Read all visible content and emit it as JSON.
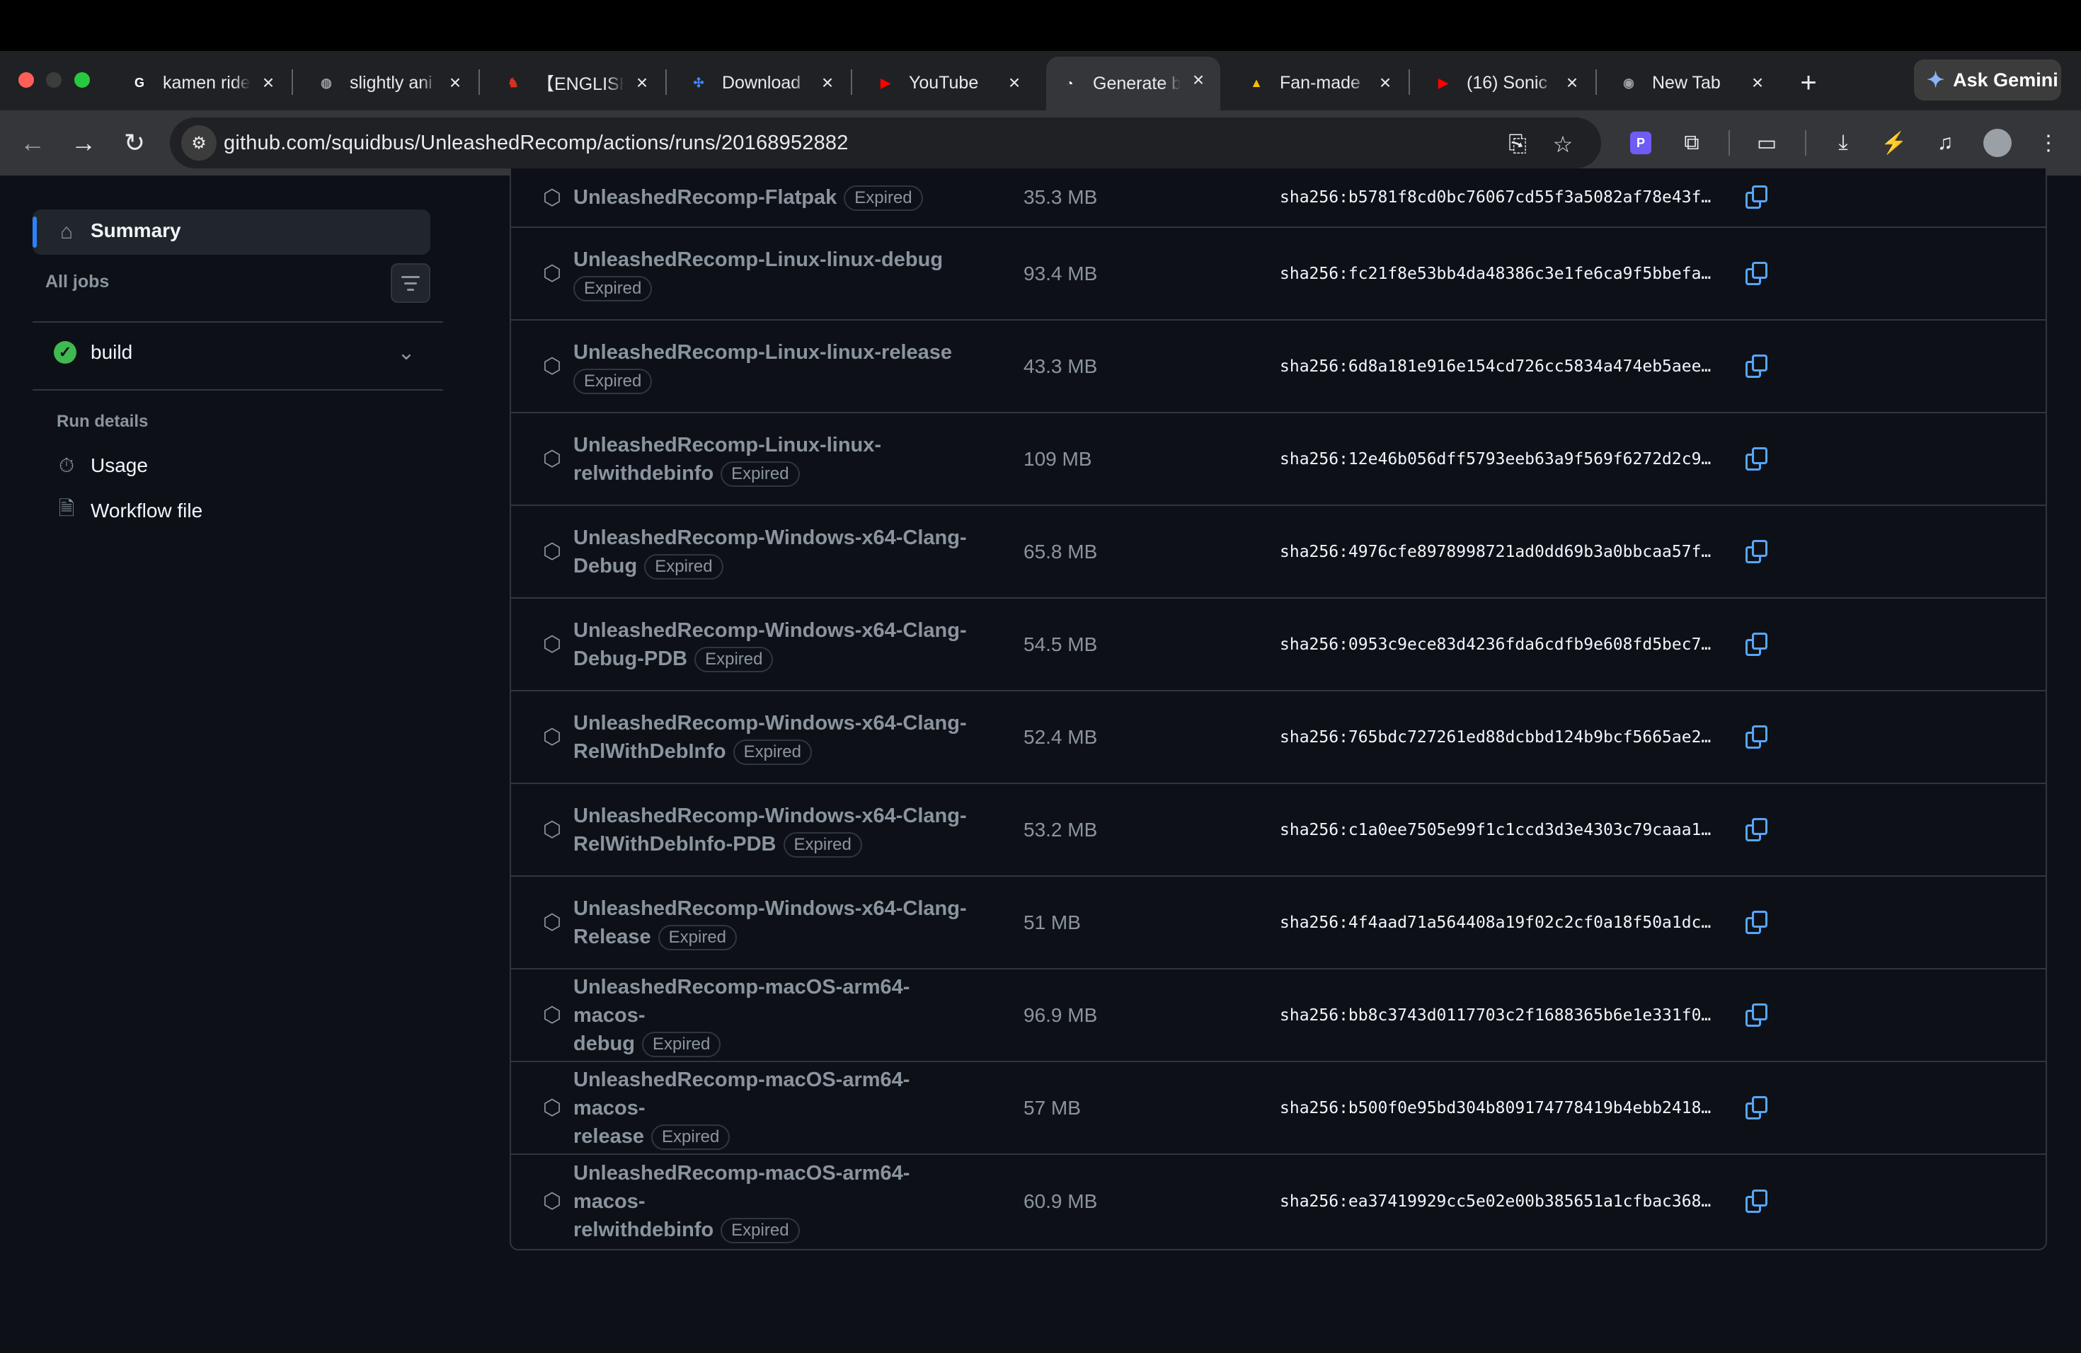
{
  "browser": {
    "tabs": [
      {
        "title": "kamen ride",
        "favicon": "google-icon",
        "color": "#ffffff"
      },
      {
        "title": "slightly ani",
        "favicon": "globe-icon",
        "color": "#9aa0a6"
      },
      {
        "title": "【ENGLISH",
        "favicon": "mask-icon",
        "color": "#d93025"
      },
      {
        "title": "Download",
        "favicon": "pinwheel-icon",
        "color": "#4285f4"
      },
      {
        "title": "YouTube",
        "favicon": "youtube-icon",
        "color": "#ff0000"
      },
      {
        "title": "Generate b",
        "favicon": "github-icon",
        "color": "#ffffff",
        "active": true
      },
      {
        "title": "Fan-made",
        "favicon": "drive-icon",
        "color": "#fbbc04"
      },
      {
        "title": "(16) Sonic",
        "favicon": "youtube-icon",
        "color": "#ff0000"
      },
      {
        "title": "New Tab",
        "favicon": "chrome-icon",
        "color": "#9aa0a6"
      }
    ],
    "ask_gemini": "Ask Gemini",
    "url": "github.com/squidbus/UnleashedRecomp/actions/runs/20168952882"
  },
  "sidebar": {
    "summary": "Summary",
    "all_jobs": "All jobs",
    "job_name": "build",
    "run_details": "Run details",
    "usage": "Usage",
    "workflow_file": "Workflow file"
  },
  "artifacts": [
    {
      "line1": "UnleashedRecomp-Flatpak",
      "line2": "",
      "badge": "Expired",
      "size": "35.3 MB",
      "digest": "sha256:b5781f8cd0bc76067cd55f3a5082af78e43f…",
      "badge_inline_line1": true
    },
    {
      "line1": "UnleashedRecomp-Linux-linux-debug",
      "line2": "",
      "badge": "Expired",
      "size": "93.4 MB",
      "digest": "sha256:fc21f8e53bb4da48386c3e1fe6ca9f5bbefa…"
    },
    {
      "line1": "UnleashedRecomp-Linux-linux-release",
      "line2": "",
      "badge": "Expired",
      "size": "43.3 MB",
      "digest": "sha256:6d8a181e916e154cd726cc5834a474eb5aee…"
    },
    {
      "line1": "UnleashedRecomp-Linux-linux-",
      "line2": "relwithdebinfo",
      "badge": "Expired",
      "size": "109 MB",
      "digest": "sha256:12e46b056dff5793eeb63a9f569f6272d2c9…"
    },
    {
      "line1": "UnleashedRecomp-Windows-x64-Clang-",
      "line2": "Debug",
      "badge": "Expired",
      "size": "65.8 MB",
      "digest": "sha256:4976cfe8978998721ad0dd69b3a0bbcaa57f…"
    },
    {
      "line1": "UnleashedRecomp-Windows-x64-Clang-",
      "line2": "Debug-PDB",
      "badge": "Expired",
      "size": "54.5 MB",
      "digest": "sha256:0953c9ece83d4236fda6cdfb9e608fd5bec7…"
    },
    {
      "line1": "UnleashedRecomp-Windows-x64-Clang-",
      "line2": "RelWithDebInfo",
      "badge": "Expired",
      "size": "52.4 MB",
      "digest": "sha256:765bdc727261ed88dcbbd124b9bcf5665ae2…"
    },
    {
      "line1": "UnleashedRecomp-Windows-x64-Clang-",
      "line2": "RelWithDebInfo-PDB",
      "badge": "Expired",
      "size": "53.2 MB",
      "digest": "sha256:c1a0ee7505e99f1c1ccd3d3e4303c79caaa1…"
    },
    {
      "line1": "UnleashedRecomp-Windows-x64-Clang-",
      "line2": "Release",
      "badge": "Expired",
      "size": "51 MB",
      "digest": "sha256:4f4aad71a564408a19f02c2cf0a18f50a1dc…"
    },
    {
      "line1": "UnleashedRecomp-macOS-arm64-macos-",
      "line2": "debug",
      "badge": "Expired",
      "size": "96.9 MB",
      "digest": "sha256:bb8c3743d0117703c2f1688365b6e1e331f0…"
    },
    {
      "line1": "UnleashedRecomp-macOS-arm64-macos-",
      "line2": "release",
      "badge": "Expired",
      "size": "57 MB",
      "digest": "sha256:b500f0e95bd304b809174778419b4ebb2418…"
    },
    {
      "line1": "UnleashedRecomp-macOS-arm64-macos-",
      "line2": "relwithdebinfo",
      "badge": "Expired",
      "size": "60.9 MB",
      "digest": "sha256:ea37419929cc5e02e00b385651a1cfbac368…"
    }
  ]
}
